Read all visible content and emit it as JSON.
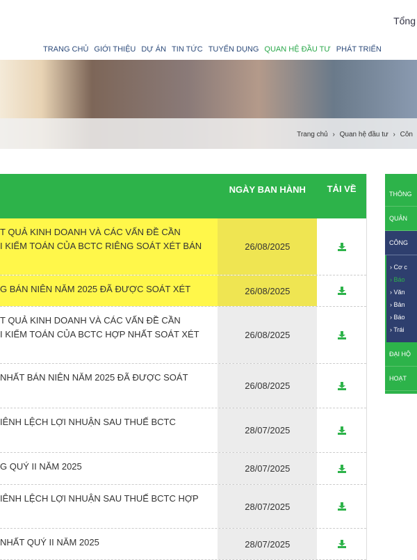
{
  "header": {
    "top_text": "Tổng"
  },
  "nav": [
    "TRANG CHỦ",
    "GIỚI THIỆU",
    "DỰ ÁN",
    "TIN TỨC",
    "TUYỂN DỤNG",
    "QUAN HỆ ĐẦU TƯ",
    "PHÁT TRIỂN"
  ],
  "breadcrumb": [
    "Trang chủ",
    "›",
    "Quan hệ đầu tư",
    "›",
    "Côn"
  ],
  "table": {
    "headers": {
      "date": "NGÀY BAN HÀNH",
      "download": "TẢI VỀ"
    },
    "rows": [
      {
        "lines": [
          "T QUẢ KINH DOANH VÀ CÁC VẤN ĐỀ CẦN",
          "I KIỂM TOÁN CỦA BCTC RIÊNG SOÁT XÉT BÁN"
        ],
        "date": "26/08/2025",
        "hl": true,
        "h": 82
      },
      {
        "lines": [
          "G BÁN NIÊN NĂM 2025 ĐÃ ĐƯỢC SOÁT XÉT"
        ],
        "date": "26/08/2025",
        "hl": true,
        "h": 45
      },
      {
        "lines": [
          "T QUẢ KINH DOANH VÀ CÁC VẤN ĐỀ CẦN",
          "I KIỂM TOÁN CỦA BCTC HỢP NHẤT SOÁT XÉT"
        ],
        "date": "26/08/2025",
        "h": 82
      },
      {
        "lines": [
          "NHẤT BÁN NIÊN NĂM 2025 ĐÃ ĐƯỢC SOÁT"
        ],
        "date": "26/08/2025",
        "h": 64
      },
      {
        "lines": [
          "IÊNH LỆCH LỢI NHUẬN SAU THUẾ BCTC"
        ],
        "date": "28/07/2025",
        "h": 64
      },
      {
        "lines": [
          "G QUÝ II NĂM 2025"
        ],
        "date": "28/07/2025",
        "h": 46
      },
      {
        "lines": [
          "IÊNH LỆCH LỢI NHUẬN SAU THUẾ BCTC HỢP"
        ],
        "date": "28/07/2025",
        "h": 63
      },
      {
        "lines": [
          "NHẤT QUÝ II NĂM 2025"
        ],
        "date": "28/07/2025",
        "h": 45
      }
    ]
  },
  "sidebar": {
    "items": [
      "THÔNG",
      "QUẢN",
      "CÔNG",
      "ĐẠI HỘ",
      "HOẠT"
    ],
    "sub": [
      "› Cơ c",
      "› Báo",
      "› Văn",
      "› Bản",
      "› Báo",
      "› Trái"
    ]
  },
  "colors": {
    "green": "#2db34a",
    "navy": "#2e3f6e",
    "highlight": "#fff74a"
  }
}
